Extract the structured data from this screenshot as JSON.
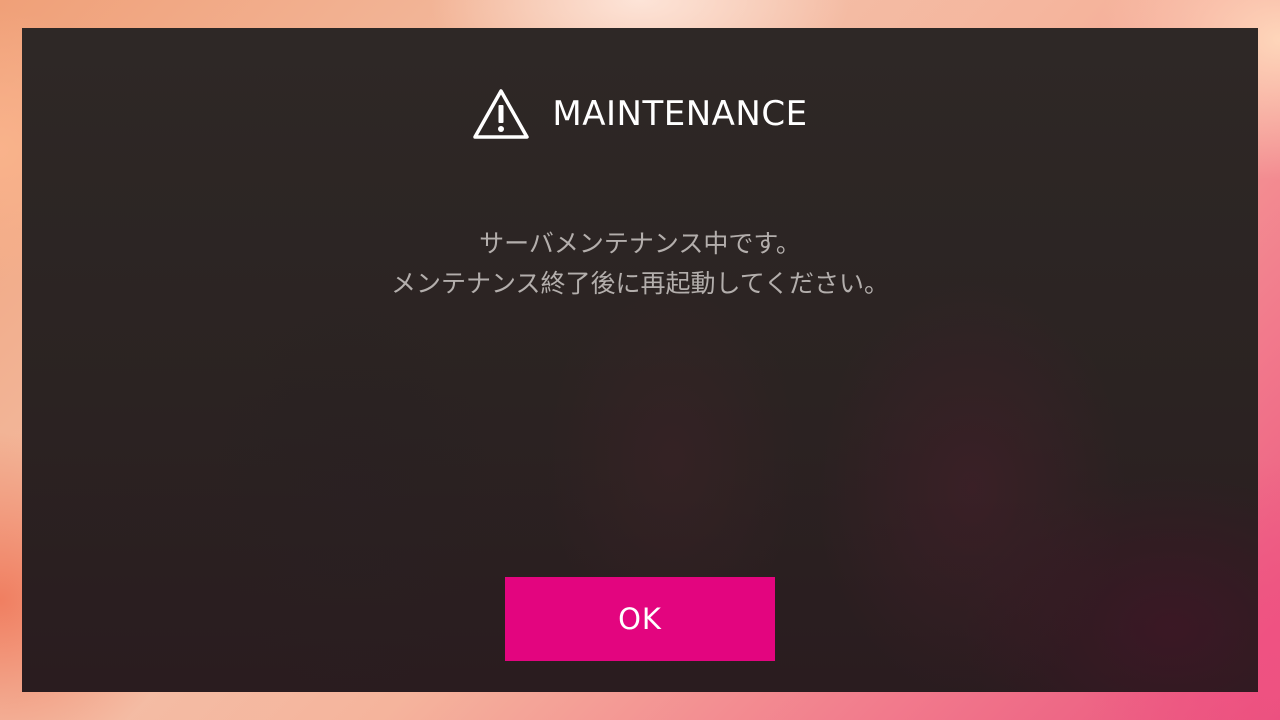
{
  "dialog": {
    "icon": "warning-triangle-icon",
    "title": "MAINTENANCE",
    "message_lines": [
      "サーバメンテナンス中です。",
      "メンテナンス終了後に再起動してください。"
    ],
    "ok_label": "OK"
  },
  "colors": {
    "button": "#e3057f",
    "dialog_background": "#2b2422",
    "title_text": "#ffffff",
    "message_text": "#b3aeac"
  }
}
